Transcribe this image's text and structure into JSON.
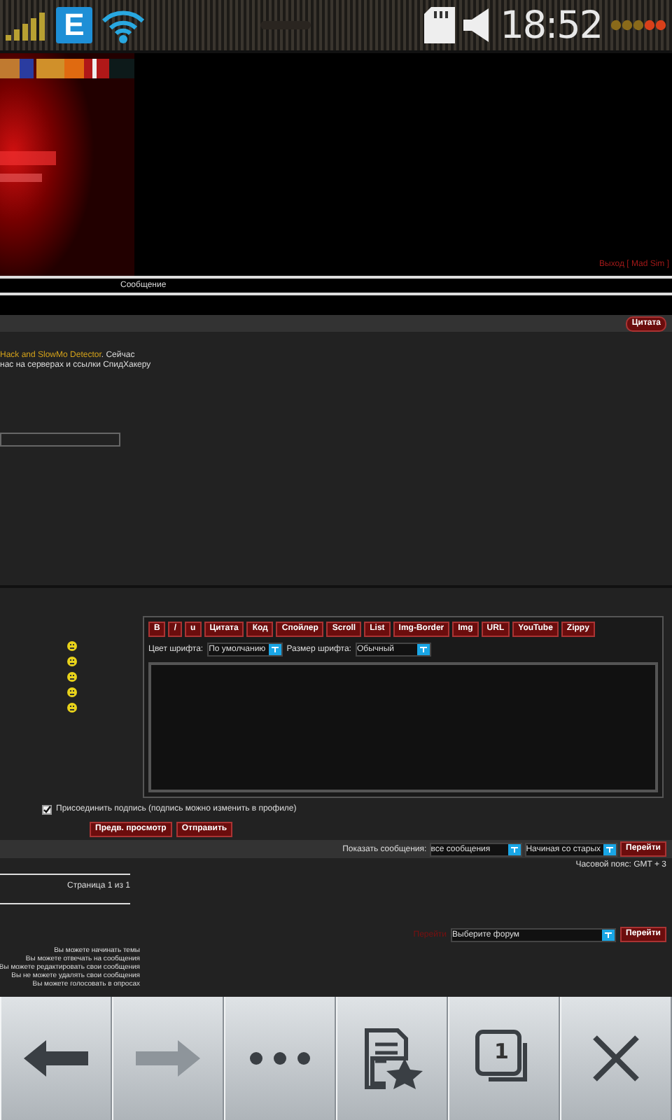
{
  "status_bar": {
    "network": "E",
    "time": "18:52"
  },
  "header": {
    "user_link": "Выход [ Mad Sim ]"
  },
  "message_label": "Сообщение",
  "post": {
    "quote_button": "Цитата",
    "link": "Hack and SlowMo Detector",
    "text_after": ". Сейчас",
    "line_2": "нас на серверах и ссылки СпидХакеру"
  },
  "editor": {
    "tags": [
      "B",
      "/",
      "u",
      "Цитата",
      "Код",
      "Спойлер",
      "Scroll",
      "List",
      "Img-Border",
      "Img",
      "URL",
      "YouTube",
      "Zippy"
    ],
    "color_label": "Цвет шрифта:",
    "color_value": "По умолчанию",
    "size_label": "Размер шрифта:",
    "size_value": "Обычный"
  },
  "signature": {
    "label": "Присоединить подпись (подпись можно изменить в профиле)",
    "checked": true
  },
  "buttons": [
    "Предв. просмотр",
    "Отправить"
  ],
  "display": {
    "label": "Показать сообщения:",
    "filter_value": "все сообщения",
    "order_value": "Начиная со старых",
    "button": "Перейти"
  },
  "timezone": "Часовой пояс: GMT + 3",
  "pagination": "Страница 1 из 1",
  "jump": {
    "label": "Перейти",
    "value": "Выберите форум",
    "button": "Перейти"
  },
  "permissions": [
    "Вы можете начинать темы",
    "Вы можете отвечать на сообщения",
    "Вы можете редактировать свои сообщения",
    "Вы не можете удалять свои сообщения",
    "Вы можете голосовать в опросах"
  ],
  "browser_toolbar": {
    "windows_count": "1"
  }
}
